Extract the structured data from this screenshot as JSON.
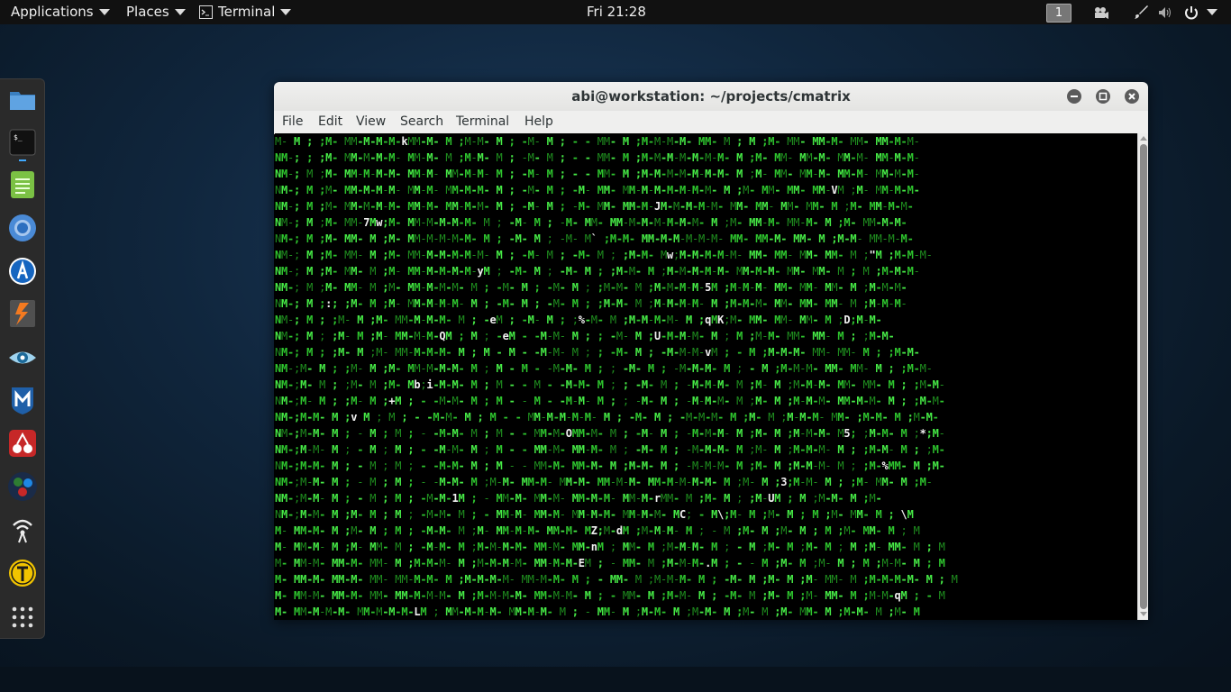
{
  "topbar": {
    "applications": "Applications",
    "places": "Places",
    "terminal": "Terminal",
    "clock": "Fri 21:28",
    "workspace": "1"
  },
  "icons": {
    "topbar": [
      "terminal-small-icon",
      "video-cam-icon",
      "brush-icon",
      "speaker-icon",
      "power-icon"
    ],
    "dock": [
      "file-manager-icon",
      "terminal-icon",
      "notes-icon",
      "chromium-icon",
      "burpsuite-icon",
      "lightning-icon",
      "eye-icon",
      "metasploit-icon",
      "cherrytree-icon",
      "maltego-icon",
      "wireless-icon",
      "faraday-icon",
      "show-apps-icon"
    ]
  },
  "colors": {
    "matrix_green": "#2ec52e",
    "matrix_bright": "#46ea46",
    "matrix_dim": "#1f8f1f",
    "matrix_white": "#f0f0f0"
  },
  "window": {
    "title": "abi@workstation: ~/projects/cmatrix"
  },
  "menu": [
    "File",
    "Edit",
    "View",
    "Search",
    "Terminal",
    "Help"
  ],
  "matrix_lines": [
    "M- M ; ;M- MM-M-M-M-kMM-M- M ;M-M- M ; -M- M ; - - MM- M ;M-M-M-M- MM- M ; M ;M- MM- MM-M- MM- MM-M-M-",
    "NM-; ; ;M- MM-M-M-M- MM-M- M ;M-M- M ; -M- M ; - - MM- M ;M-M-M-M-M-M-M- M ;M- MM- MM-M- MM-M- MM-M-M-",
    "NM-; M ;M- MM-M-M-M- MM-M- MM-M-M- M ; -M- M ; - - MM- M ;M-M-M-M-M-M-M- M ;M- MM- MM-M- MM-M- MM-M-M-",
    "NM-; M ;M- MM-M-M-M- MM-M- MM-M-M- M ; -M- M ; -M- MM- MM-M-M-M-M-M-M- M ;M- MM- MM- MM-VM ;M- MM-M-M-",
    "NM-; M ;M- MM-M-M-M- MM-M- MM-M-M- M ; -M- M ; -M- MM- MM-M-JM-M-M-M-M- MM- MM- MM- MM- M ;M- MM-M-M-",
    "NM-; M ;M- MM-7Mw;M- MM-M-M-M-M- M ; -M- M ; -M- MM- MM-M-M-M-M-M-M- M ;M- MM-M- MM-M- M ;M- MM-M-M-",
    "NM-; M ;M- MM- M ;M- MM-M-M-M-M- M ; -M- M ; -M- M` ;M-M- MM-M-M-M-M-M- MM- MM-M- MM- M ;M-M- MM-M-M-",
    "NM-; M ;M- MM- M ;M- MM-M-M-M-M-M- M ; -M- M ; -M- M ; ;M-M- Mw;M-M-M-M-M- MM- MM- MM- MM- M ;\"M ;M-M-M-",
    "NM-; M ;M- MM- M ;M- MM-M-M-M-M-yM ; -M- M ; -M- M ; ;M-M- M ;M-M-M-M-M- MM-M-M- MM- MM- M ; M ;M-M-M-",
    "NM-; M ;M- MM- M ;M- MM-M-M-M- M ; -M- M ; -M- M ; ;M-M- M ;M-M-M-M-5M ;M-M-M- MM- MM- MM- M ;M-M-M-",
    "NM-; M ;:; ;M- M ;M- MM-M-M-M- M ; -M- M ; -M- M ; ;M-M- M ;M-M-M-M- M ;M-M-M- MM- MM- MM- M ;M-M-M-",
    "NM-; M ; ;M- M ;M- MM-M-M-M- M ; -eM ; -M- M ; ;%-M- M ;M-M-M-M- M ;qMK;M- MM- MM- MM- M ;D;M-M-",
    "NM-; M ; ;M- M ;M- MM-M-M-QM ; M ; -eM - -M-M- M ; ; -M- M ;U-M-M-M- M ; M ;M-M- MM- MM- M ; ;M-M-",
    "NM-; M ; ;M- M ;M- MM-M-M-M- M ; M - M - -M-M- M ; ; -M- M ; -M-M-M-vM ; - M ;M-M-M- MM- MM- M ; ;M-M-",
    "NM-;M- M ; ;M- M ;M- MM-M-M-M- M ; M - M - -M-M- M ; ; -M- M ; -M-M-M- M ; - M ;M-M-M- MM- MM- M ; ;M-M-",
    "NM-;M- M ; ;M- M ;M- Mb;i-M-M- M ; M - - M - -M-M- M ; ; -M- M ; -M-M-M- M ;M- M ;M-M-M- MM- MM- M ; ;M-M-",
    "NM-;M- M ; ;M- M ;+M ; - -M-M- M ; M - - M - -M-M- M ; ; -M- M ; -M-M-M- M ;M- M ;M-M-M- MM-M-M- M ; ;M-M-",
    "NM-;M-M- M ;v M ; M ; - -M-M- M ; M - - MM-M-M-M-M- M ; -M- M ; -M-M-M- M ;M- M ;M-M-M- MM- ;M-M- M ;M-M-",
    "NM-;M-M- M ; - M ; M ; - -M-M- M ; M - - MM-M-OMM-M- M ; -M- M ; -M-M-M- M ;M- M ;M-M-M- M5; ;M-M- M ;*;M-",
    "NM-;M-M- M ; - M ; M ; - -M-M- M ; M - - MM-M- MM-M- M ; -M- M ; -M-M-M- M ;M- M ;M-M-M- M ; ;M-M- M ; ;M-",
    "NM-;M-M- M ; - M ; M ; - -M-M- M ; M - - MM-M- MM-M- M ;M-M- M ; -M-M-M- M ;M- M ;M-M-M- M ; ;M-%MM- M ;M-",
    "NM-;M-M- M ; - M ; M ; - -M-M- M ;M-M- MM-M- MM-M- MM-M-M- MM-M-M-M-M- M ;M- M ;3;M-M- M ; ;M- MM- M ;M-",
    "NM-;M-M- M ; - M ; M ; -M-M-1M ; - MM-M- MM-M- MM-M-M- MM-M-rMM- M ;M- M ; ;M-UM ; M ;M-M- M ;M-",
    "NM-;M-M- M ;M- M ; M ; -M-M- M ; - MM-M- MM-M- MM-M-M- MM-M-M- MC; - M\\;M- M ;M- M ; M ;M- MM- M ; \\M",
    "M- MM-M- M ;M- M ; M ; -M-M- M ;M- MM-M-M- MM-M- MZ;M-dM ;M-M-M- M ; - M ;M- M ;M- M ; M ;M- MM- M ; M",
    "M- MM-M- M ;M- MM- M ; -M-M- M ;M-M-M-M- MM-M- MM-nM ; MM- M ;M-M-M- M ; - M ;M- M ;M- M ; M ;M- MM- M ; M",
    "M- MM-M- MM-M- MM- M ;M-M-M- M ;M-M-M-M- MM-M-M-EM ; - MM- M ;M-M-M-.M ; - - M ;M- M ;M- M ; M ;M-M- M ; M",
    "M- MM-M- MM-M- MM- MM-M-M- M ;M-M-M-M- MM-M-M- M ; - MM- M ;M-M-M- M ; -M- M ;M- M ;M- MM- M ;M-M-M-M- M ; M",
    "M- MM-M- MM-M- MM- MM-M-M-M- M ;M-M-M-M- MM-M-M- M ; - MM- M ;M-M- M ; -M- M ;M- M ;M- MM- M ;M-M-qM ; - M",
    "M- MM-M-M-M- MM-M-M-M-LM ; MM-M-M-M- MM-M-M- M ; - MM- M ;M-M- M ;M-M- M ;M- M ;M- MM- M ;M-M- M ;M- M"
  ]
}
